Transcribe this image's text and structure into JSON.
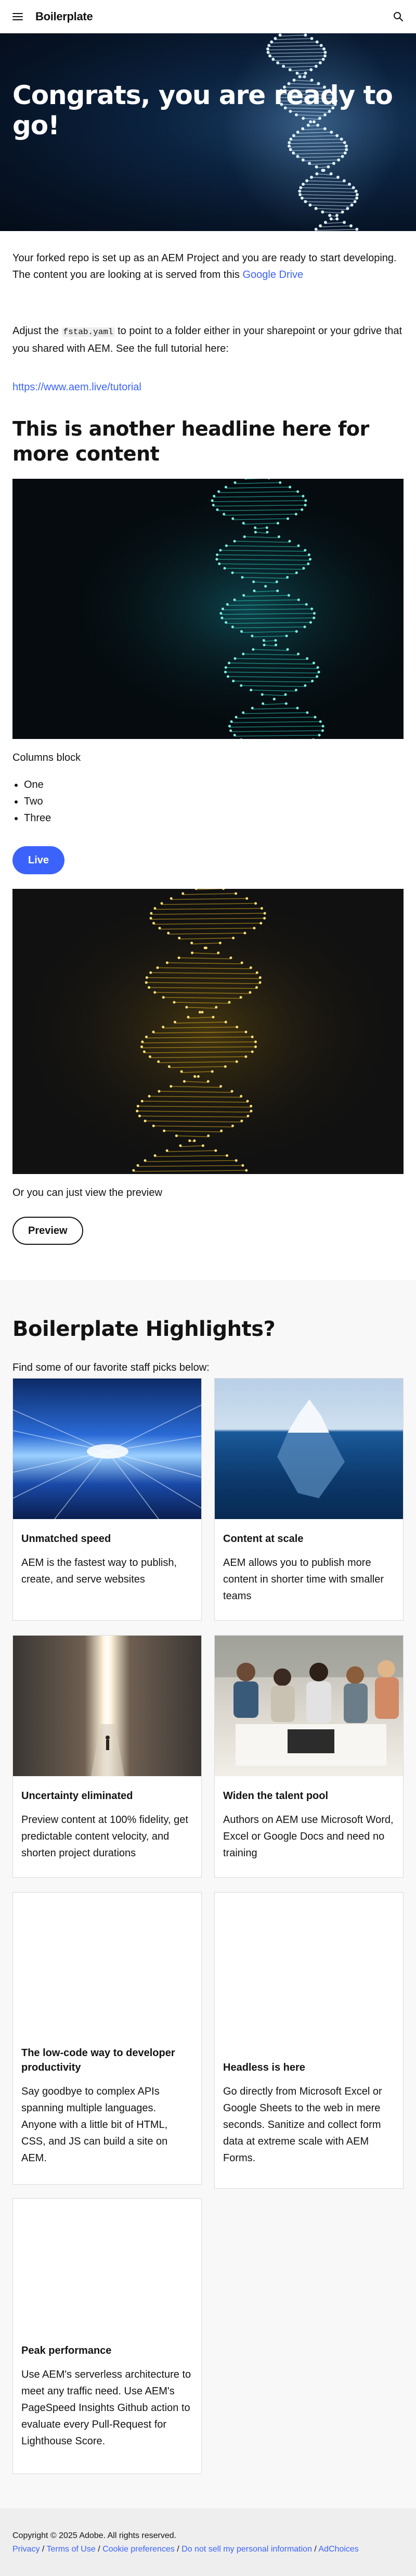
{
  "header": {
    "brand": "Boilerplate"
  },
  "hero": {
    "title": "Congrats, you are ready to go!"
  },
  "intro": {
    "line1": "Your forked repo is set up as an AEM Project and you are ready to start developing.",
    "line2_prefix": "The content you are looking at is served from this ",
    "line2_link": "Google Drive",
    "adjust_prefix": "Adjust the ",
    "adjust_code": "fstab.yaml",
    "adjust_suffix": " to point to a folder either in your sharepoint or your gdrive that you shared with AEM. See the full tutorial here:",
    "tutorial_link": "https://www.aem.live/tutorial"
  },
  "headline2": "This is another headline here for more content",
  "columns": {
    "label": "Columns block",
    "items": [
      "One",
      "Two",
      "Three"
    ],
    "live_button": "Live",
    "preview_text": "Or you can just view the preview",
    "preview_button": "Preview"
  },
  "highlights": {
    "title": "Boilerplate Highlights?",
    "subtitle": "Find some of our favorite staff picks below:",
    "cards": [
      {
        "title": "Unmatched speed",
        "text": "AEM is the fastest way to publish, create, and serve websites"
      },
      {
        "title": "Content at scale",
        "text": "AEM allows you to publish more content in shorter time with smaller teams"
      },
      {
        "title": "Uncertainty eliminated",
        "text": "Preview content at 100% fidelity, get predictable content velocity, and shorten project durations"
      },
      {
        "title": "Widen the talent pool",
        "text": "Authors on AEM use Microsoft Word, Excel or Google Docs and need no training"
      },
      {
        "title": "The low-code way to developer productivity",
        "text": "Say goodbye to complex APIs spanning multiple languages. Anyone with a little bit of HTML, CSS, and JS can build a site on AEM."
      },
      {
        "title": "Headless is here",
        "text": "Go directly from Microsoft Excel or Google Sheets to the web in mere seconds. Sanitize and collect form data at extreme scale with AEM Forms."
      },
      {
        "title": "Peak performance",
        "text": "Use AEM's serverless architecture to meet any traffic need. Use AEM's PageSpeed Insights Github action to evaluate every Pull-Request for Lighthouse Score."
      }
    ]
  },
  "footer": {
    "copyright": "Copyright © 2025 Adobe. All rights reserved.",
    "links": [
      "Privacy",
      "Terms of Use",
      "Cookie preferences",
      "Do not sell my personal information",
      "AdChoices"
    ],
    "separator": " / "
  },
  "colors": {
    "accent": "#3b63fb",
    "text": "#131313",
    "section_bg": "#f8f8f8",
    "footer_bg": "#eeeeee"
  }
}
